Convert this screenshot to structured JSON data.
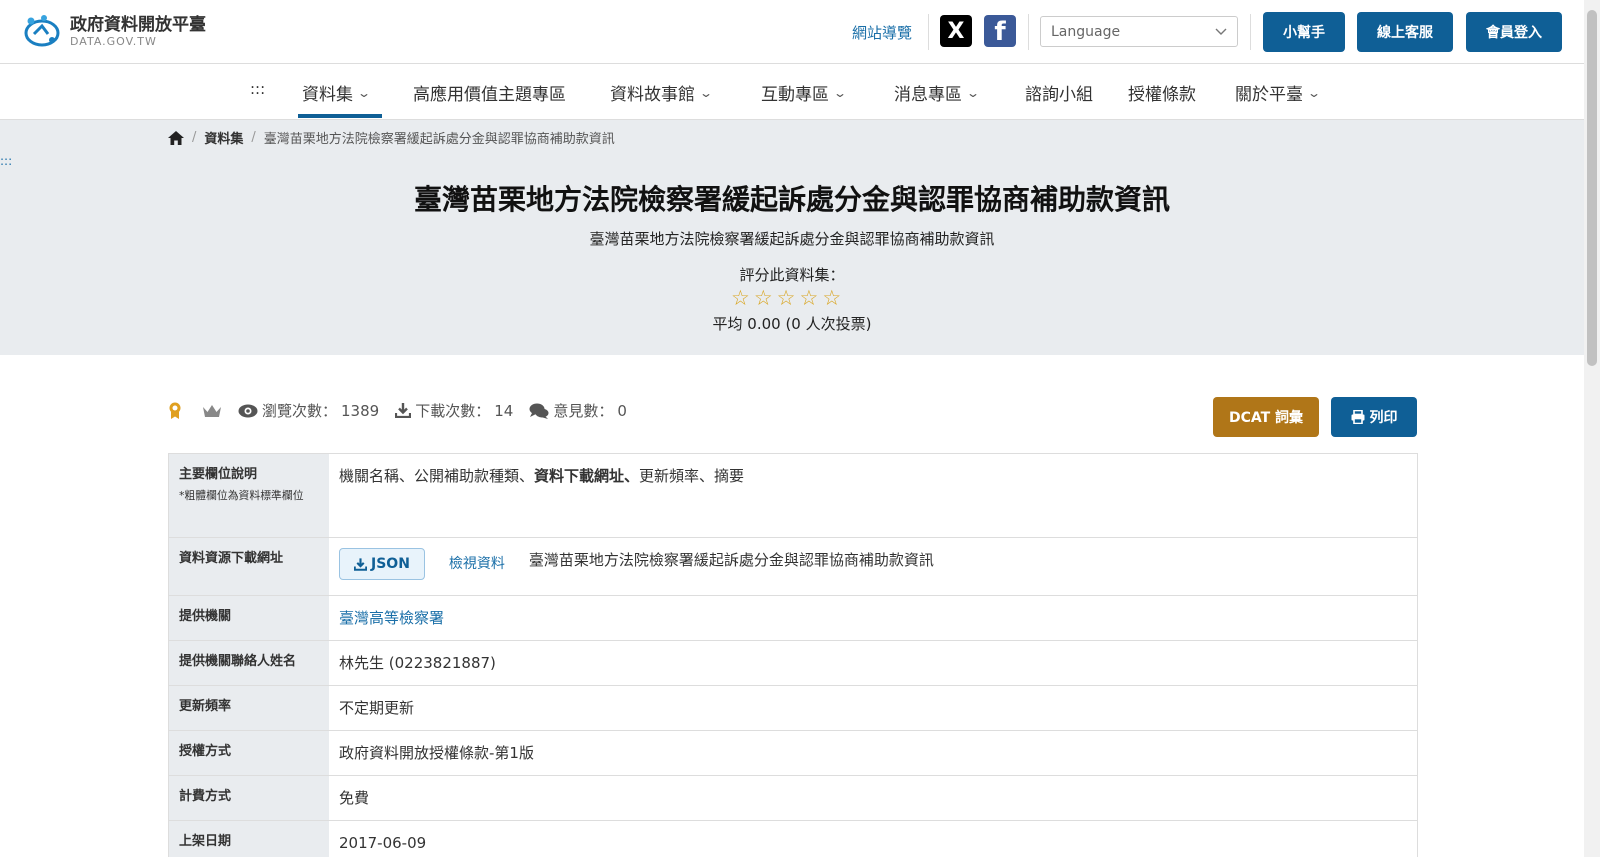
{
  "header": {
    "logo_title": "政府資料開放平臺",
    "logo_subtitle": "DATA.GOV.TW",
    "sitemap": "網站導覽",
    "social_x": "X",
    "social_fb": "f",
    "language_placeholder": "Language",
    "helper_btn": "小幫手",
    "service_btn": "線上客服",
    "login_btn": "會員登入"
  },
  "nav": {
    "accesskey": ":::",
    "items": [
      "資料集",
      "高應用價值主題專區",
      "資料故事館",
      "互動專區",
      "消息專區",
      "諮詢小組",
      "授權條款",
      "關於平臺"
    ]
  },
  "breadcrumb": {
    "level1": "資料集",
    "current": "臺灣苗栗地方法院檢察署緩起訴處分金與認罪協商補助款資訊"
  },
  "hero": {
    "accesskey": ":::",
    "title": "臺灣苗栗地方法院檢察署緩起訴處分金與認罪協商補助款資訊",
    "subtitle": "臺灣苗栗地方法院檢察署緩起訴處分金與認罪協商補助款資訊",
    "rate_label": "評分此資料集：",
    "rating_value": 0,
    "rating_max": 5,
    "avg_text": "平均 0.00 (0 人次投票)"
  },
  "stats": {
    "views_label": "瀏覽次數：",
    "views": "1389",
    "downloads_label": "下載次數：",
    "downloads": "14",
    "comments_label": "意見數：",
    "comments": "0"
  },
  "actions": {
    "dcat": "DCAT 詞彙",
    "print": "列印"
  },
  "table": {
    "fields_label": "主要欄位說明",
    "fields_note": "*粗體欄位為資料標準欄位",
    "fields_value_1": "機關名稱、公開補助款種類、",
    "fields_value_bold": "資料下載網址、",
    "fields_value_2": "更新頻率、摘要",
    "resource_label": "資料資源下載網址",
    "resource_format": "JSON",
    "resource_view": "檢視資料",
    "resource_name": "臺灣苗栗地方法院檢察署緩起訴處分金與認罪協商補助款資訊",
    "provider_label": "提供機關",
    "provider_value": "臺灣高等檢察署",
    "contact_label": "提供機關聯絡人姓名",
    "contact_value": "林先生 (0223821887)",
    "frequency_label": "更新頻率",
    "frequency_value": "不定期更新",
    "license_label": "授權方式",
    "license_value": "政府資料開放授權條款-第1版",
    "fee_label": "計費方式",
    "fee_value": "免費",
    "date_label": "上架日期",
    "date_value": "2017-06-09"
  },
  "colors": {
    "primary": "#0f5f96",
    "dcat": "#b07618",
    "star": "#d9a520",
    "hero_bg": "#e9ecef"
  }
}
